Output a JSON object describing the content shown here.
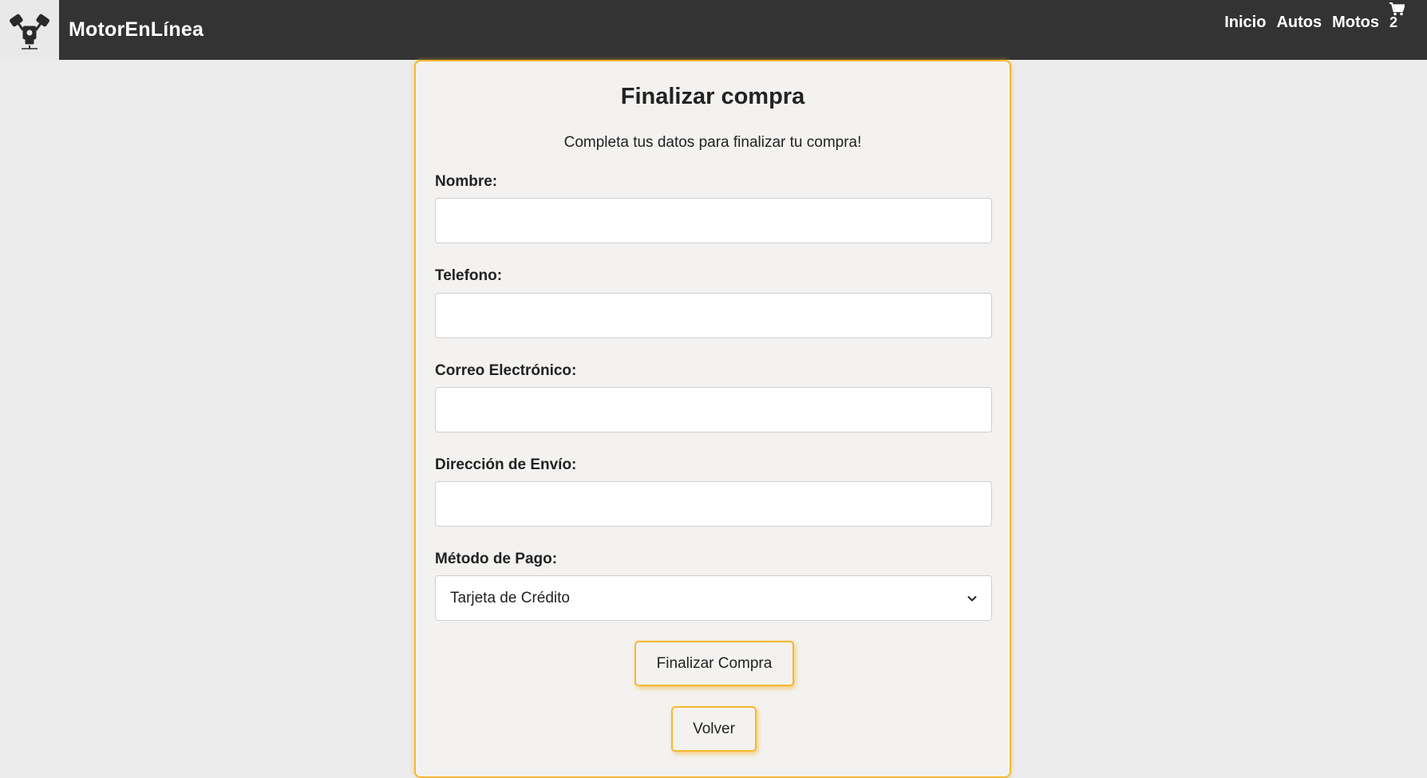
{
  "header": {
    "brand": "MotorEnLínea",
    "logo_icon": "engine-pistons-icon",
    "nav": [
      {
        "label": "Inicio"
      },
      {
        "label": "Autos"
      },
      {
        "label": "Motos"
      }
    ],
    "cart": {
      "icon": "cart-icon",
      "count": "2"
    }
  },
  "checkout": {
    "title": "Finalizar compra",
    "subtitle": "Completa tus datos para finalizar tu compra!",
    "fields": {
      "nombre": {
        "label": "Nombre:",
        "value": ""
      },
      "telefono": {
        "label": "Telefono:",
        "value": ""
      },
      "correo": {
        "label": "Correo Electrónico:",
        "value": ""
      },
      "direccion": {
        "label": "Dirección de Envío:",
        "value": ""
      },
      "pago": {
        "label": "Método de Pago:",
        "value": "Tarjeta de Crédito"
      }
    },
    "submit_label": "Finalizar Compra",
    "back_label": "Volver"
  },
  "colors": {
    "header_bg": "#333333",
    "accent": "#f7b731",
    "page_bg": "#ececec",
    "card_bg": "#f3f2f0"
  }
}
